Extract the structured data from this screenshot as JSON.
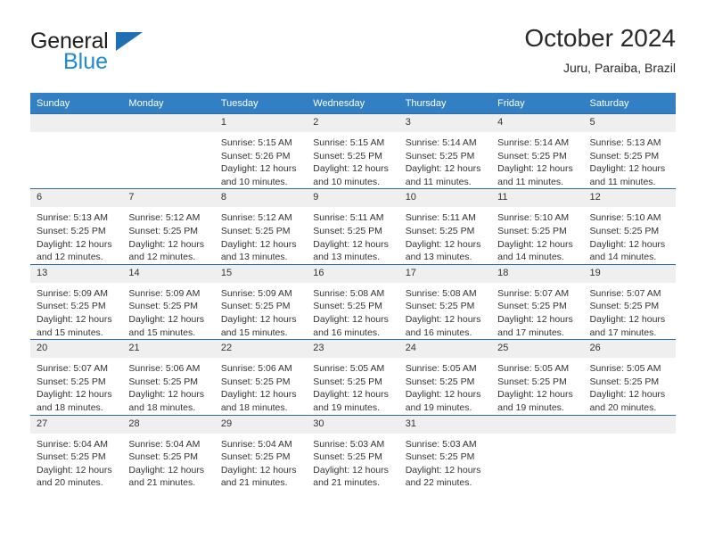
{
  "logo": {
    "word1": "General",
    "word2": "Blue",
    "triangle_color": "#1f6fb5",
    "blue_color": "#1c8ad4"
  },
  "header": {
    "title": "October 2024",
    "subtitle": "Juru, Paraiba, Brazil"
  },
  "theme": {
    "header_bg": "#3280c3",
    "row_line": "#2e6da4",
    "daynum_bg": "#efefef",
    "text": "#333333"
  },
  "weekdays": [
    "Sunday",
    "Monday",
    "Tuesday",
    "Wednesday",
    "Thursday",
    "Friday",
    "Saturday"
  ],
  "weeks": [
    [
      {
        "day": "",
        "lines": []
      },
      {
        "day": "",
        "lines": []
      },
      {
        "day": "1",
        "lines": [
          "Sunrise: 5:15 AM",
          "Sunset: 5:26 PM",
          "Daylight: 12 hours",
          "and 10 minutes."
        ]
      },
      {
        "day": "2",
        "lines": [
          "Sunrise: 5:15 AM",
          "Sunset: 5:25 PM",
          "Daylight: 12 hours",
          "and 10 minutes."
        ]
      },
      {
        "day": "3",
        "lines": [
          "Sunrise: 5:14 AM",
          "Sunset: 5:25 PM",
          "Daylight: 12 hours",
          "and 11 minutes."
        ]
      },
      {
        "day": "4",
        "lines": [
          "Sunrise: 5:14 AM",
          "Sunset: 5:25 PM",
          "Daylight: 12 hours",
          "and 11 minutes."
        ]
      },
      {
        "day": "5",
        "lines": [
          "Sunrise: 5:13 AM",
          "Sunset: 5:25 PM",
          "Daylight: 12 hours",
          "and 11 minutes."
        ]
      }
    ],
    [
      {
        "day": "6",
        "lines": [
          "Sunrise: 5:13 AM",
          "Sunset: 5:25 PM",
          "Daylight: 12 hours",
          "and 12 minutes."
        ]
      },
      {
        "day": "7",
        "lines": [
          "Sunrise: 5:12 AM",
          "Sunset: 5:25 PM",
          "Daylight: 12 hours",
          "and 12 minutes."
        ]
      },
      {
        "day": "8",
        "lines": [
          "Sunrise: 5:12 AM",
          "Sunset: 5:25 PM",
          "Daylight: 12 hours",
          "and 13 minutes."
        ]
      },
      {
        "day": "9",
        "lines": [
          "Sunrise: 5:11 AM",
          "Sunset: 5:25 PM",
          "Daylight: 12 hours",
          "and 13 minutes."
        ]
      },
      {
        "day": "10",
        "lines": [
          "Sunrise: 5:11 AM",
          "Sunset: 5:25 PM",
          "Daylight: 12 hours",
          "and 13 minutes."
        ]
      },
      {
        "day": "11",
        "lines": [
          "Sunrise: 5:10 AM",
          "Sunset: 5:25 PM",
          "Daylight: 12 hours",
          "and 14 minutes."
        ]
      },
      {
        "day": "12",
        "lines": [
          "Sunrise: 5:10 AM",
          "Sunset: 5:25 PM",
          "Daylight: 12 hours",
          "and 14 minutes."
        ]
      }
    ],
    [
      {
        "day": "13",
        "lines": [
          "Sunrise: 5:09 AM",
          "Sunset: 5:25 PM",
          "Daylight: 12 hours",
          "and 15 minutes."
        ]
      },
      {
        "day": "14",
        "lines": [
          "Sunrise: 5:09 AM",
          "Sunset: 5:25 PM",
          "Daylight: 12 hours",
          "and 15 minutes."
        ]
      },
      {
        "day": "15",
        "lines": [
          "Sunrise: 5:09 AM",
          "Sunset: 5:25 PM",
          "Daylight: 12 hours",
          "and 15 minutes."
        ]
      },
      {
        "day": "16",
        "lines": [
          "Sunrise: 5:08 AM",
          "Sunset: 5:25 PM",
          "Daylight: 12 hours",
          "and 16 minutes."
        ]
      },
      {
        "day": "17",
        "lines": [
          "Sunrise: 5:08 AM",
          "Sunset: 5:25 PM",
          "Daylight: 12 hours",
          "and 16 minutes."
        ]
      },
      {
        "day": "18",
        "lines": [
          "Sunrise: 5:07 AM",
          "Sunset: 5:25 PM",
          "Daylight: 12 hours",
          "and 17 minutes."
        ]
      },
      {
        "day": "19",
        "lines": [
          "Sunrise: 5:07 AM",
          "Sunset: 5:25 PM",
          "Daylight: 12 hours",
          "and 17 minutes."
        ]
      }
    ],
    [
      {
        "day": "20",
        "lines": [
          "Sunrise: 5:07 AM",
          "Sunset: 5:25 PM",
          "Daylight: 12 hours",
          "and 18 minutes."
        ]
      },
      {
        "day": "21",
        "lines": [
          "Sunrise: 5:06 AM",
          "Sunset: 5:25 PM",
          "Daylight: 12 hours",
          "and 18 minutes."
        ]
      },
      {
        "day": "22",
        "lines": [
          "Sunrise: 5:06 AM",
          "Sunset: 5:25 PM",
          "Daylight: 12 hours",
          "and 18 minutes."
        ]
      },
      {
        "day": "23",
        "lines": [
          "Sunrise: 5:05 AM",
          "Sunset: 5:25 PM",
          "Daylight: 12 hours",
          "and 19 minutes."
        ]
      },
      {
        "day": "24",
        "lines": [
          "Sunrise: 5:05 AM",
          "Sunset: 5:25 PM",
          "Daylight: 12 hours",
          "and 19 minutes."
        ]
      },
      {
        "day": "25",
        "lines": [
          "Sunrise: 5:05 AM",
          "Sunset: 5:25 PM",
          "Daylight: 12 hours",
          "and 19 minutes."
        ]
      },
      {
        "day": "26",
        "lines": [
          "Sunrise: 5:05 AM",
          "Sunset: 5:25 PM",
          "Daylight: 12 hours",
          "and 20 minutes."
        ]
      }
    ],
    [
      {
        "day": "27",
        "lines": [
          "Sunrise: 5:04 AM",
          "Sunset: 5:25 PM",
          "Daylight: 12 hours",
          "and 20 minutes."
        ]
      },
      {
        "day": "28",
        "lines": [
          "Sunrise: 5:04 AM",
          "Sunset: 5:25 PM",
          "Daylight: 12 hours",
          "and 21 minutes."
        ]
      },
      {
        "day": "29",
        "lines": [
          "Sunrise: 5:04 AM",
          "Sunset: 5:25 PM",
          "Daylight: 12 hours",
          "and 21 minutes."
        ]
      },
      {
        "day": "30",
        "lines": [
          "Sunrise: 5:03 AM",
          "Sunset: 5:25 PM",
          "Daylight: 12 hours",
          "and 21 minutes."
        ]
      },
      {
        "day": "31",
        "lines": [
          "Sunrise: 5:03 AM",
          "Sunset: 5:25 PM",
          "Daylight: 12 hours",
          "and 22 minutes."
        ]
      },
      {
        "day": "",
        "lines": []
      },
      {
        "day": "",
        "lines": []
      }
    ]
  ]
}
